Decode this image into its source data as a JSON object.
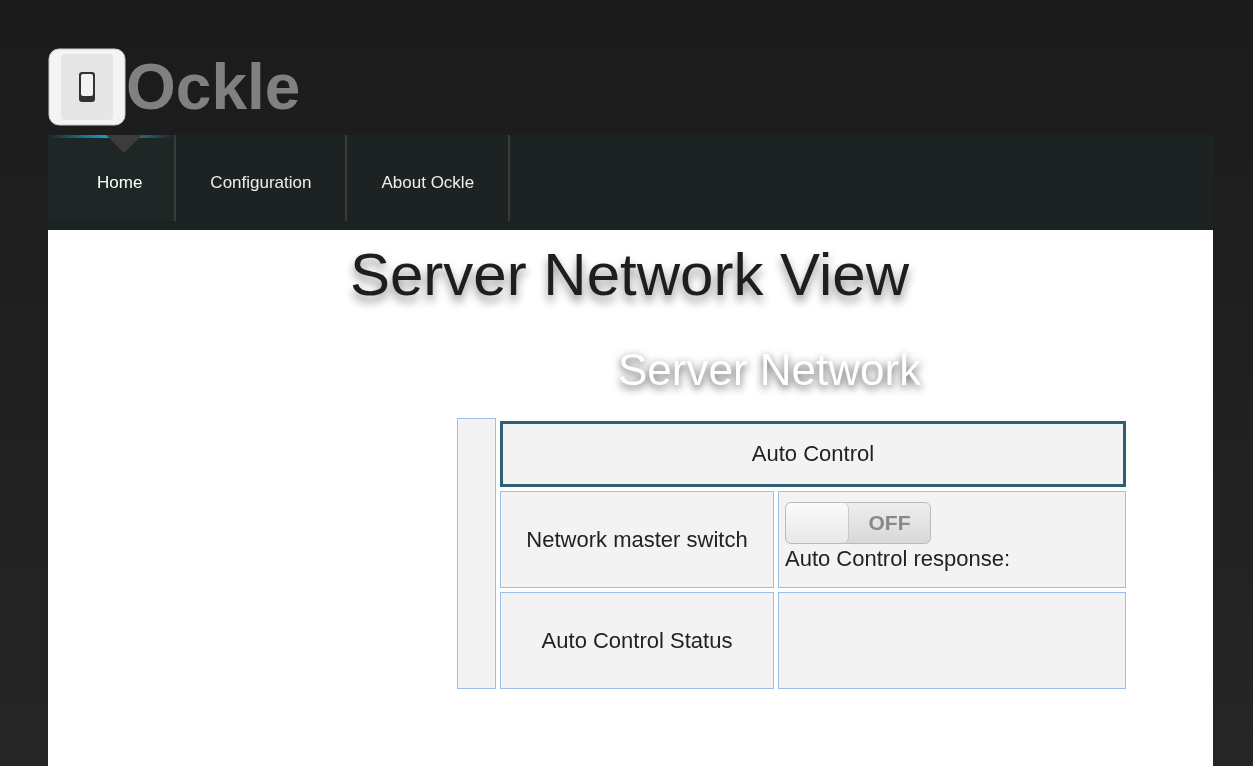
{
  "logo": {
    "name": "Ockle"
  },
  "nav": [
    {
      "label": "Home",
      "selected": true
    },
    {
      "label": "Configuration",
      "selected": false
    },
    {
      "label": "About Ockle",
      "selected": false
    }
  ],
  "page_title": "Server Network View",
  "section_title": "Server Network",
  "table": {
    "header": "Auto Control",
    "rows": [
      {
        "label": "Network master switch",
        "kind": "switch",
        "toggle": {
          "label": "OFF",
          "on": false
        },
        "note": "Auto Control response:"
      },
      {
        "label": "Auto Control Status",
        "kind": "empty"
      }
    ]
  }
}
